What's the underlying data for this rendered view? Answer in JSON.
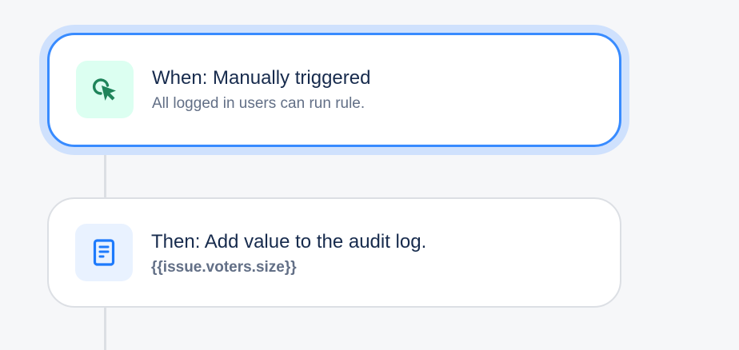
{
  "colors": {
    "background": "#f6f7f9",
    "connector": "#dcdfe4",
    "selected_border": "#388bff",
    "selected_glow": "#cfe1fd",
    "trigger_icon_bg": "#dcfff1",
    "trigger_icon_fg": "#1f845a",
    "action_icon_bg": "#e9f2ff",
    "action_icon_fg": "#1d7afc",
    "title_text": "#172b4d",
    "sub_text": "#626f86"
  },
  "trigger": {
    "icon": "cursor-click-icon",
    "title": "When: Manually triggered",
    "description": "All logged in users can run rule."
  },
  "action": {
    "icon": "document-icon",
    "title": "Then: Add value to the audit log.",
    "value": "{{issue.voters.size}}"
  }
}
